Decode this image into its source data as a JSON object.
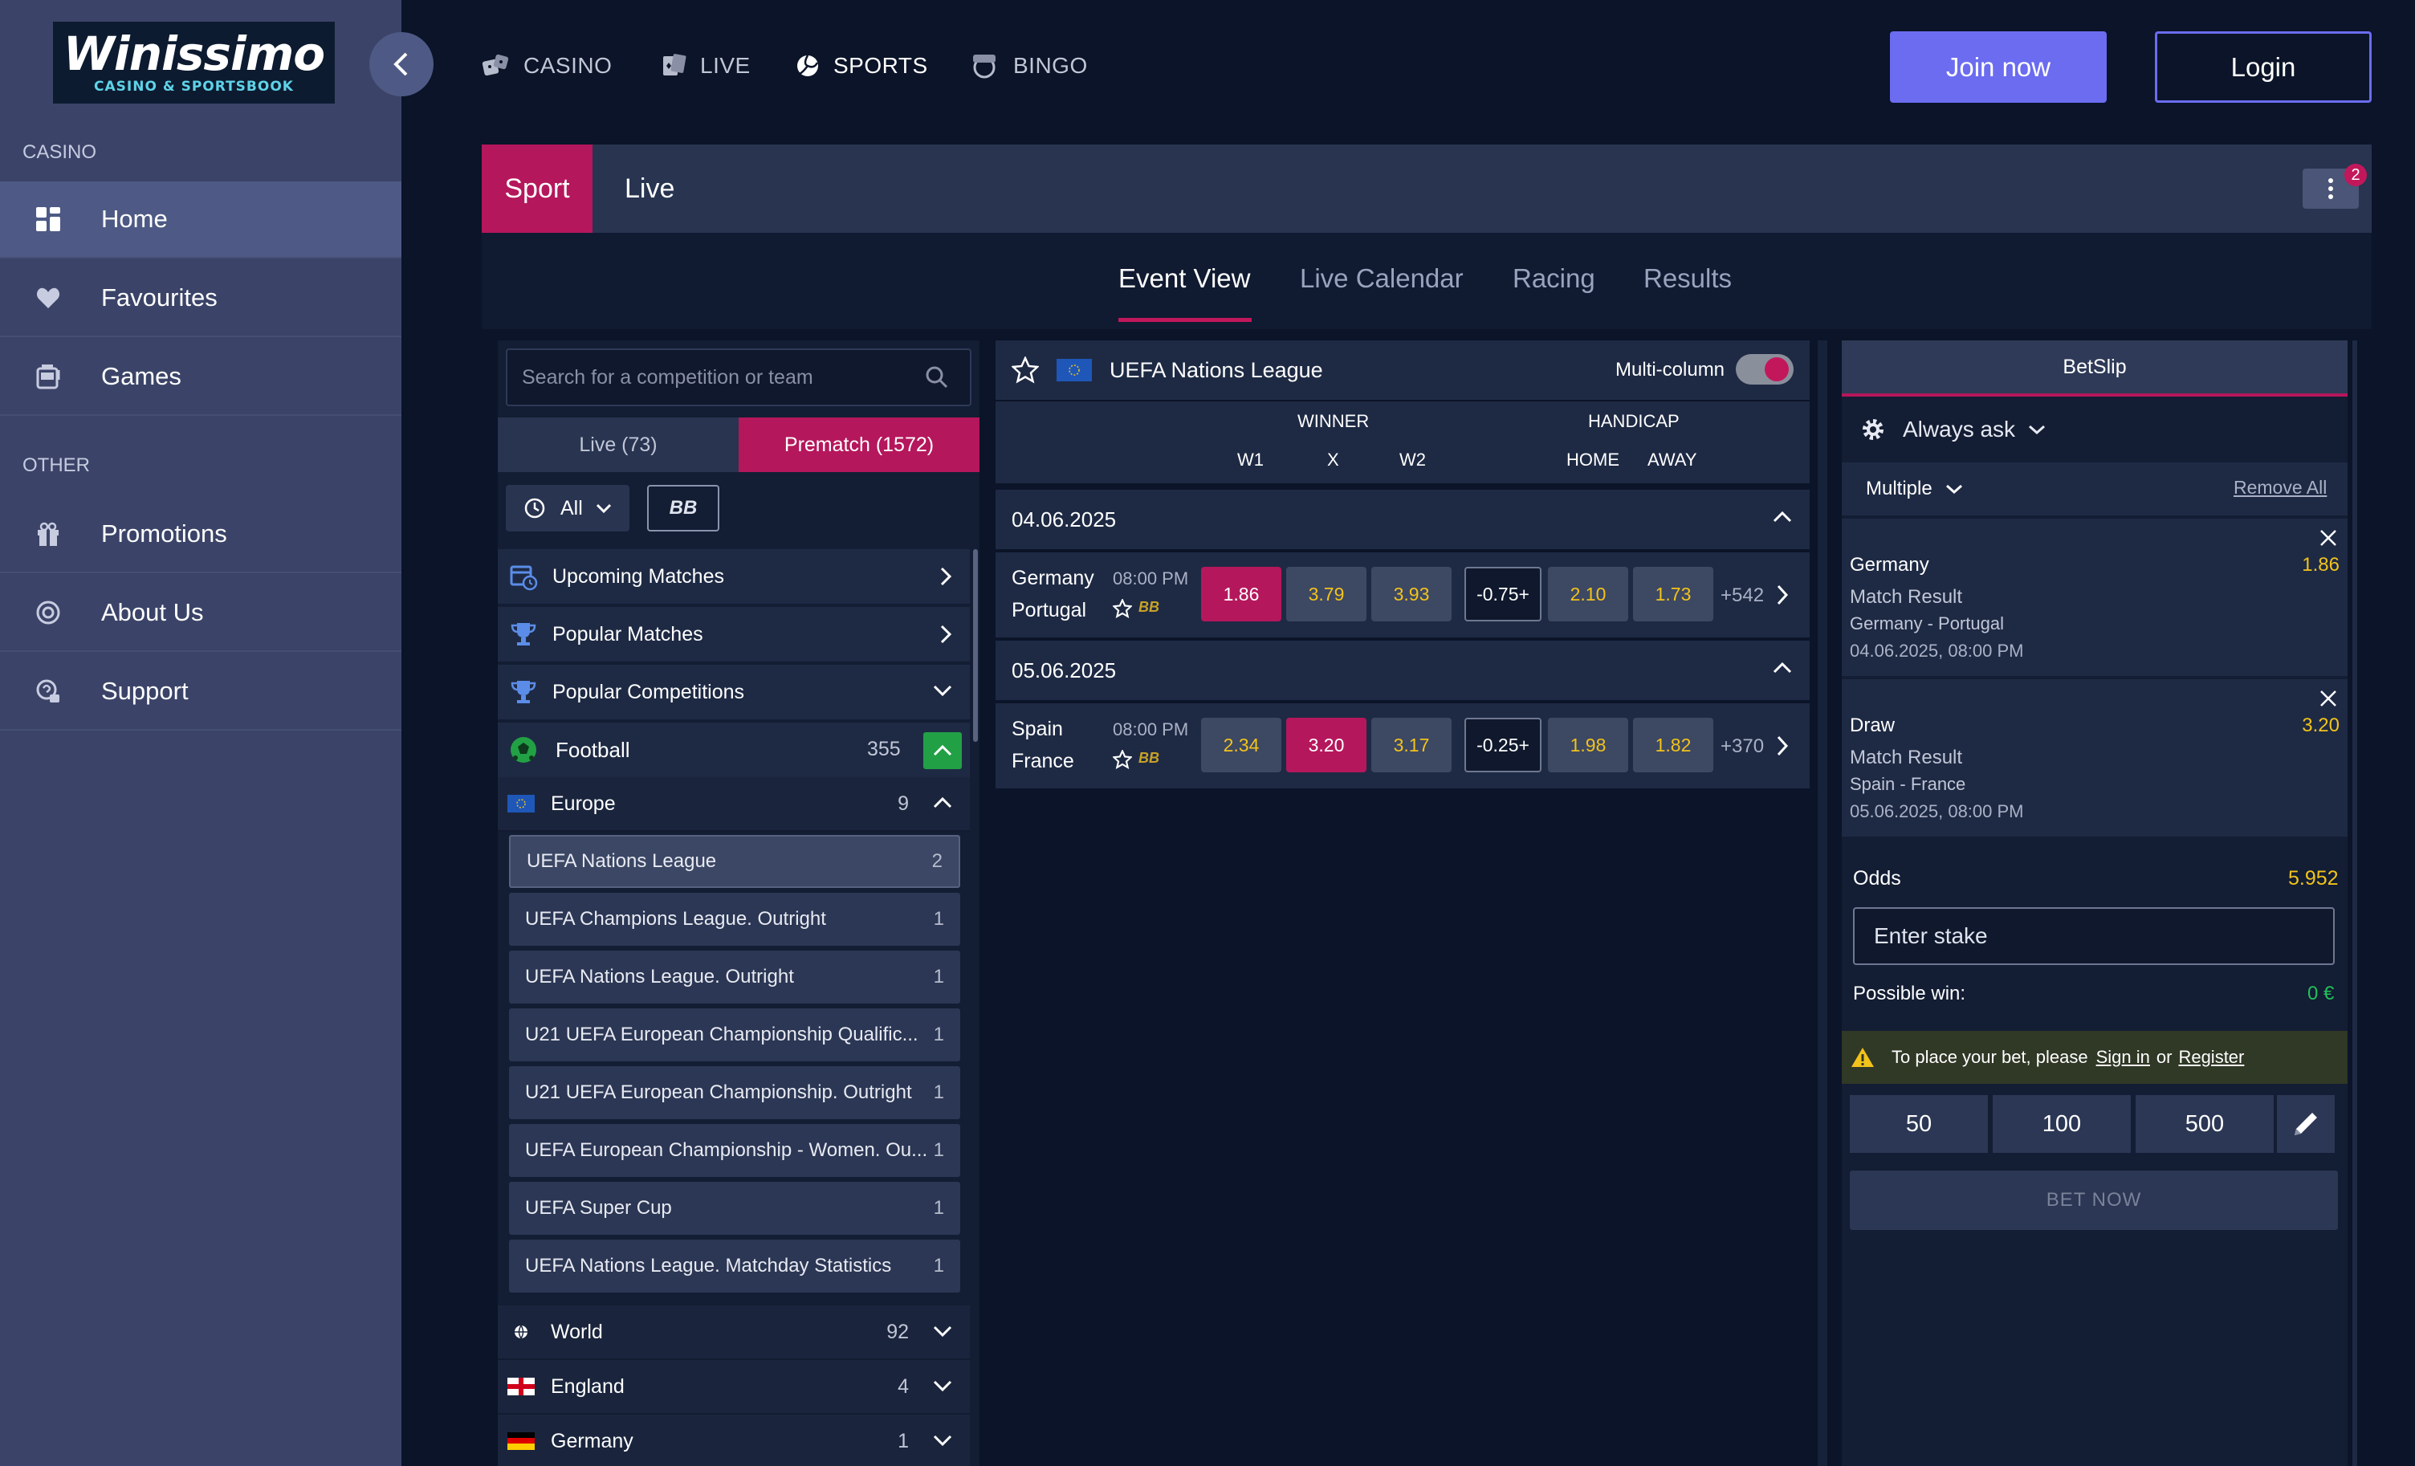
{
  "brand": {
    "logo_line1": "Winissimo",
    "logo_line2": "CASINO & SPORTSBOOK"
  },
  "sidebar": {
    "section_casino": "CASINO",
    "section_other": "OTHER",
    "items": [
      {
        "label": "Home",
        "icon": "home-grid-icon",
        "active": true
      },
      {
        "label": "Favourites",
        "icon": "heart-icon"
      },
      {
        "label": "Games",
        "icon": "slot-machine-icon"
      },
      {
        "label": "Promotions",
        "icon": "gift-icon"
      },
      {
        "label": "About Us",
        "icon": "chip-icon"
      },
      {
        "label": "Support",
        "icon": "support-chat-icon"
      }
    ]
  },
  "topnav": {
    "items": [
      {
        "label": "CASINO",
        "icon": "dice-icon"
      },
      {
        "label": "LIVE",
        "icon": "cards-icon"
      },
      {
        "label": "SPORTS",
        "icon": "volleyball-icon",
        "active": true
      },
      {
        "label": "BINGO",
        "icon": "bingo-ball-icon"
      }
    ],
    "join_label": "Join now",
    "login_label": "Login"
  },
  "sportbar": {
    "tab_sport": "Sport",
    "tab_live": "Live",
    "notifications": "2"
  },
  "subnav": {
    "tabs": [
      "Event View",
      "Live Calendar",
      "Racing",
      "Results"
    ],
    "active": "Event View"
  },
  "left_panel": {
    "search_placeholder": "Search for a competition or team",
    "tab_live": "Live (73)",
    "tab_prematch": "Prematch (1572)",
    "filter_all": "All",
    "filter_bb": "BB",
    "categories": [
      "Upcoming Matches",
      "Popular Matches",
      "Popular Competitions"
    ],
    "sport": {
      "name": "Football",
      "count": "355"
    },
    "region_open": {
      "name": "Europe",
      "count": "9"
    },
    "competitions": [
      {
        "name": "UEFA Nations League",
        "count": "2"
      },
      {
        "name": "UEFA Champions League. Outright",
        "count": "1"
      },
      {
        "name": "UEFA Nations League. Outright",
        "count": "1"
      },
      {
        "name": "U21 UEFA European Championship Qualific...",
        "count": "1"
      },
      {
        "name": "U21 UEFA European Championship. Outright",
        "count": "1"
      },
      {
        "name": "UEFA European Championship - Women. Ou...",
        "count": "1"
      },
      {
        "name": "UEFA Super Cup",
        "count": "1"
      },
      {
        "name": "UEFA Nations League. Matchday Statistics",
        "count": "1"
      }
    ],
    "regions": [
      {
        "name": "World",
        "count": "92"
      },
      {
        "name": "England",
        "count": "4"
      },
      {
        "name": "Germany",
        "count": "1"
      }
    ]
  },
  "middle": {
    "competition": "UEFA Nations League",
    "multicolumn_label": "Multi-column",
    "winner_header": "WINNER",
    "handicap_header": "HANDICAP",
    "col_w1": "W1",
    "col_x": "X",
    "col_w2": "W2",
    "col_home": "HOME",
    "col_away": "AWAY",
    "days": [
      {
        "date": "04.06.2025",
        "home": "Germany",
        "away": "Portugal",
        "time": "08:00 PM",
        "bb": "BB",
        "w1": "1.86",
        "x": "3.79",
        "w2": "3.93",
        "handicap": "-0.75+",
        "hc_home": "2.10",
        "hc_away": "1.73",
        "more": "+542",
        "selected": "w1"
      },
      {
        "date": "05.06.2025",
        "home": "Spain",
        "away": "France",
        "time": "08:00 PM",
        "bb": "BB",
        "w1": "2.34",
        "x": "3.20",
        "w2": "3.17",
        "handicap": "-0.25+",
        "hc_home": "1.98",
        "hc_away": "1.82",
        "more": "+370",
        "selected": "x"
      }
    ]
  },
  "betslip": {
    "title": "BetSlip",
    "always_ask": "Always ask",
    "bet_type": "Multiple",
    "remove_all": "Remove All",
    "bets": [
      {
        "selection": "Germany",
        "odds": "1.86",
        "market": "Match Result",
        "event": "Germany - Portugal",
        "datetime": "04.06.2025, 08:00 PM"
      },
      {
        "selection": "Draw",
        "odds": "3.20",
        "market": "Match Result",
        "event": "Spain - France",
        "datetime": "05.06.2025, 08:00 PM"
      }
    ],
    "odds_label": "Odds",
    "odds_value": "5.952",
    "stake_placeholder": "Enter stake",
    "possible_win_label": "Possible win:",
    "possible_win_value": "0 €",
    "warning_text": "To place your bet, please",
    "sign_in": "Sign in",
    "or": "or",
    "register": "Register",
    "quick_stakes": [
      "50",
      "100",
      "500"
    ],
    "bet_now": "BET NOW"
  },
  "colors": {
    "accent_pink": "#b5175c",
    "accent_purple": "#6b6cf0",
    "odd_yellow": "#f2c31b",
    "positive_green": "#22c05a"
  }
}
